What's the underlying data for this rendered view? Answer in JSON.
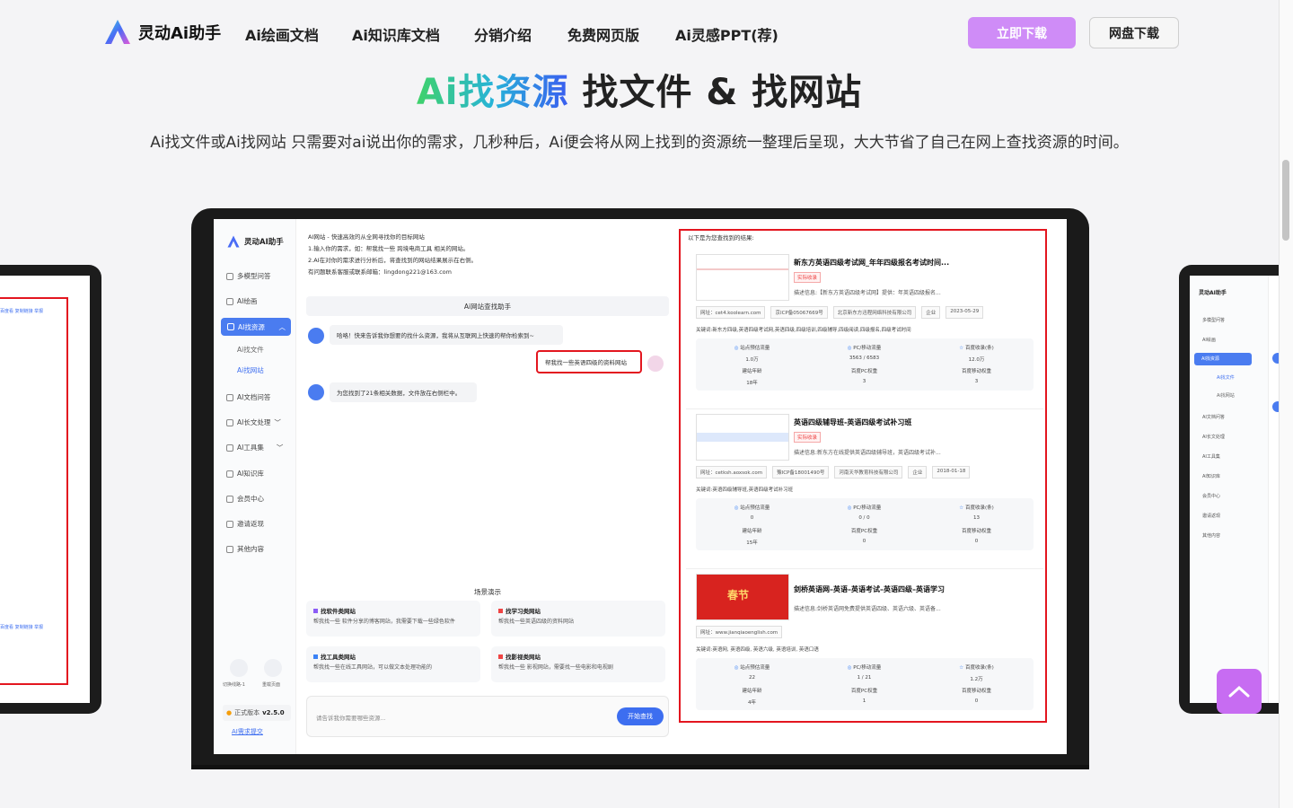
{
  "nav": {
    "logo_text": "灵动Ai助手",
    "links": [
      "Ai绘画文档",
      "Ai知识库文档",
      "分销介绍",
      "免费网页版",
      "Ai灵感PPT(荐)"
    ],
    "download_button": "立即下载",
    "pan_button": "网盘下载"
  },
  "hero": {
    "title_highlight": "Ai找资源",
    "title_rest": " 找文件 & 找网站",
    "subtitle": "Ai找文件或Ai找网站 只需要对ai说出你的需求，几秒种后，Ai便会将从网上找到的资源统一整理后呈现，大大节省了自己在网上查找资源的时间。"
  },
  "app": {
    "logo": "灵动AI助手",
    "sidebar": [
      {
        "label": "多模型问答",
        "icon": "chat-icon"
      },
      {
        "label": "AI绘画",
        "icon": "palette-icon"
      },
      {
        "label": "AI找资源",
        "icon": "search-doc-icon",
        "active": true
      },
      {
        "label": "Ai找文件",
        "icon": "",
        "sub": true
      },
      {
        "label": "Ai找网站",
        "icon": "",
        "sub": true,
        "selected": true
      },
      {
        "label": "AI文档问答",
        "icon": "doc-icon"
      },
      {
        "label": "AI长文处理",
        "icon": "text-icon"
      },
      {
        "label": "AI工具集",
        "icon": "grid-icon"
      },
      {
        "label": "AI知识库",
        "icon": "book-icon"
      },
      {
        "label": "会员中心",
        "icon": "user-icon"
      },
      {
        "label": "邀请返现",
        "icon": "gift-icon"
      },
      {
        "label": "其他内容",
        "icon": "more-icon"
      }
    ],
    "bottom": {
      "switch_line": "切换线路-1",
      "reload": "重载页面",
      "version_label": "正式版本",
      "version": "v2.5.0",
      "feedback": "AI需求提交"
    },
    "chat": {
      "intro_lines": [
        "AI网站 - 快速高效的从全网寻找你的目标网站",
        "1.输入你的需求，如：帮我找一些 跨境电商工具 相关的网站。",
        "2.AI在对你的需求进行分析后，将查找到的网站结果展示在右侧。",
        "有问题联系客服或联系邮箱：lingdong221@163.com"
      ],
      "title": "Ai网站查找助手",
      "bot_msg_1": "哈咯！快来告诉我你想要的找什么资源，我将从互联网上快速的帮你检索到~",
      "user_msg": "帮我找一些英语四级的资料网站",
      "bot_msg_2": "为您找到了21条相关数据，文件放在右侧栏中。",
      "scene_title": "场景演示",
      "cards": [
        {
          "title": "找软件类网站",
          "desc": "帮我找一些 软件分享的博客网站，我需要下载一些绿色软件",
          "color": "#8b5cf6"
        },
        {
          "title": "找学习类网站",
          "desc": "帮我找一些英语四级的资料网站",
          "color": "#ef4444"
        },
        {
          "title": "找工具类网站",
          "desc": "帮我找一些在线工具网站，可以做文本处理功能的",
          "color": "#3b82f6"
        },
        {
          "title": "找影视类网站",
          "desc": "帮我找一些 影视网站，需要找一些电影和电视剧",
          "color": "#ef4444"
        }
      ],
      "input_placeholder": "请告诉我你需要哪些资源...",
      "send_button": "开始查找"
    },
    "results": {
      "header": "以下是为您查找到的结果:",
      "items": [
        {
          "title": "新东方英语四级考试网_年年四级报名考试时间...",
          "tag": "实际收录",
          "desc": "描述信息:【新东方英语四级考试网】提供：年英语四级报名...",
          "meta": [
            "网址：cet4.koolearn.com",
            "京ICP备05067669号",
            "北京新东方迅程网络科技有限公司",
            "企业",
            "2023-05-29"
          ],
          "keywords": "关键词:新东方四级,英语四级考试网,英语四级,四级培训,四级辅导,四级阅读,四级报名,四级考试时间",
          "stats": [
            {
              "label": "站点预估流量",
              "value": "1.0万"
            },
            {
              "label": "PC/移动流量",
              "value": "3563 / 6583"
            },
            {
              "label": "百度收录(条)",
              "value": "12.0万"
            },
            {
              "label": "建站年龄",
              "value": "18年"
            },
            {
              "label": "百度PC权重",
              "value": "3"
            },
            {
              "label": "百度移动权重",
              "value": "3"
            }
          ]
        },
        {
          "title": "英语四级辅导班-英语四级考试补习班",
          "tag": "实际收录",
          "desc": "描述信息:新东方在线提供英语四级辅导班，英语四级考试补...",
          "meta": [
            "网址：cetksh.aoxsok.com",
            "豫ICP备18001490号",
            "河南天华教育科技有限公司",
            "企业",
            "2018-01-18"
          ],
          "keywords": "关键词:英语四级辅导班,英语四级考试补习班",
          "stats": [
            {
              "label": "站点预估流量",
              "value": "0"
            },
            {
              "label": "PC/移动流量",
              "value": "0 / 0"
            },
            {
              "label": "百度收录(条)",
              "value": "13"
            },
            {
              "label": "建站年龄",
              "value": "15年"
            },
            {
              "label": "百度PC权重",
              "value": "0"
            },
            {
              "label": "百度移动权重",
              "value": "0"
            }
          ]
        },
        {
          "title": "剑桥英语网–英语–英语考试–英语四级–英语学习",
          "tag": "",
          "desc": "描述信息:剑桥英语网免费提供英语四级、英语六级、英语备...",
          "meta": [
            "网址：www.jianqiaoenglish.com"
          ],
          "keywords": "关键词:英语网, 英语四级, 英语六级, 英语培训, 英语口语",
          "stats": [
            {
              "label": "站点预估流量",
              "value": "22"
            },
            {
              "label": "PC/移动流量",
              "value": "1 / 21"
            },
            {
              "label": "百度收录(条)",
              "value": "1.2万"
            },
            {
              "label": "建站年龄",
              "value": "4年"
            },
            {
              "label": "百度PC权重",
              "value": "1"
            },
            {
              "label": "百度移动权重",
              "value": "0"
            }
          ]
        }
      ]
    }
  },
  "colors": {
    "accent": "#cf8cf7",
    "brand_blue": "#4a7cf0",
    "highlight_red": "#e3161f",
    "back_to_top": "#c76cf2"
  }
}
